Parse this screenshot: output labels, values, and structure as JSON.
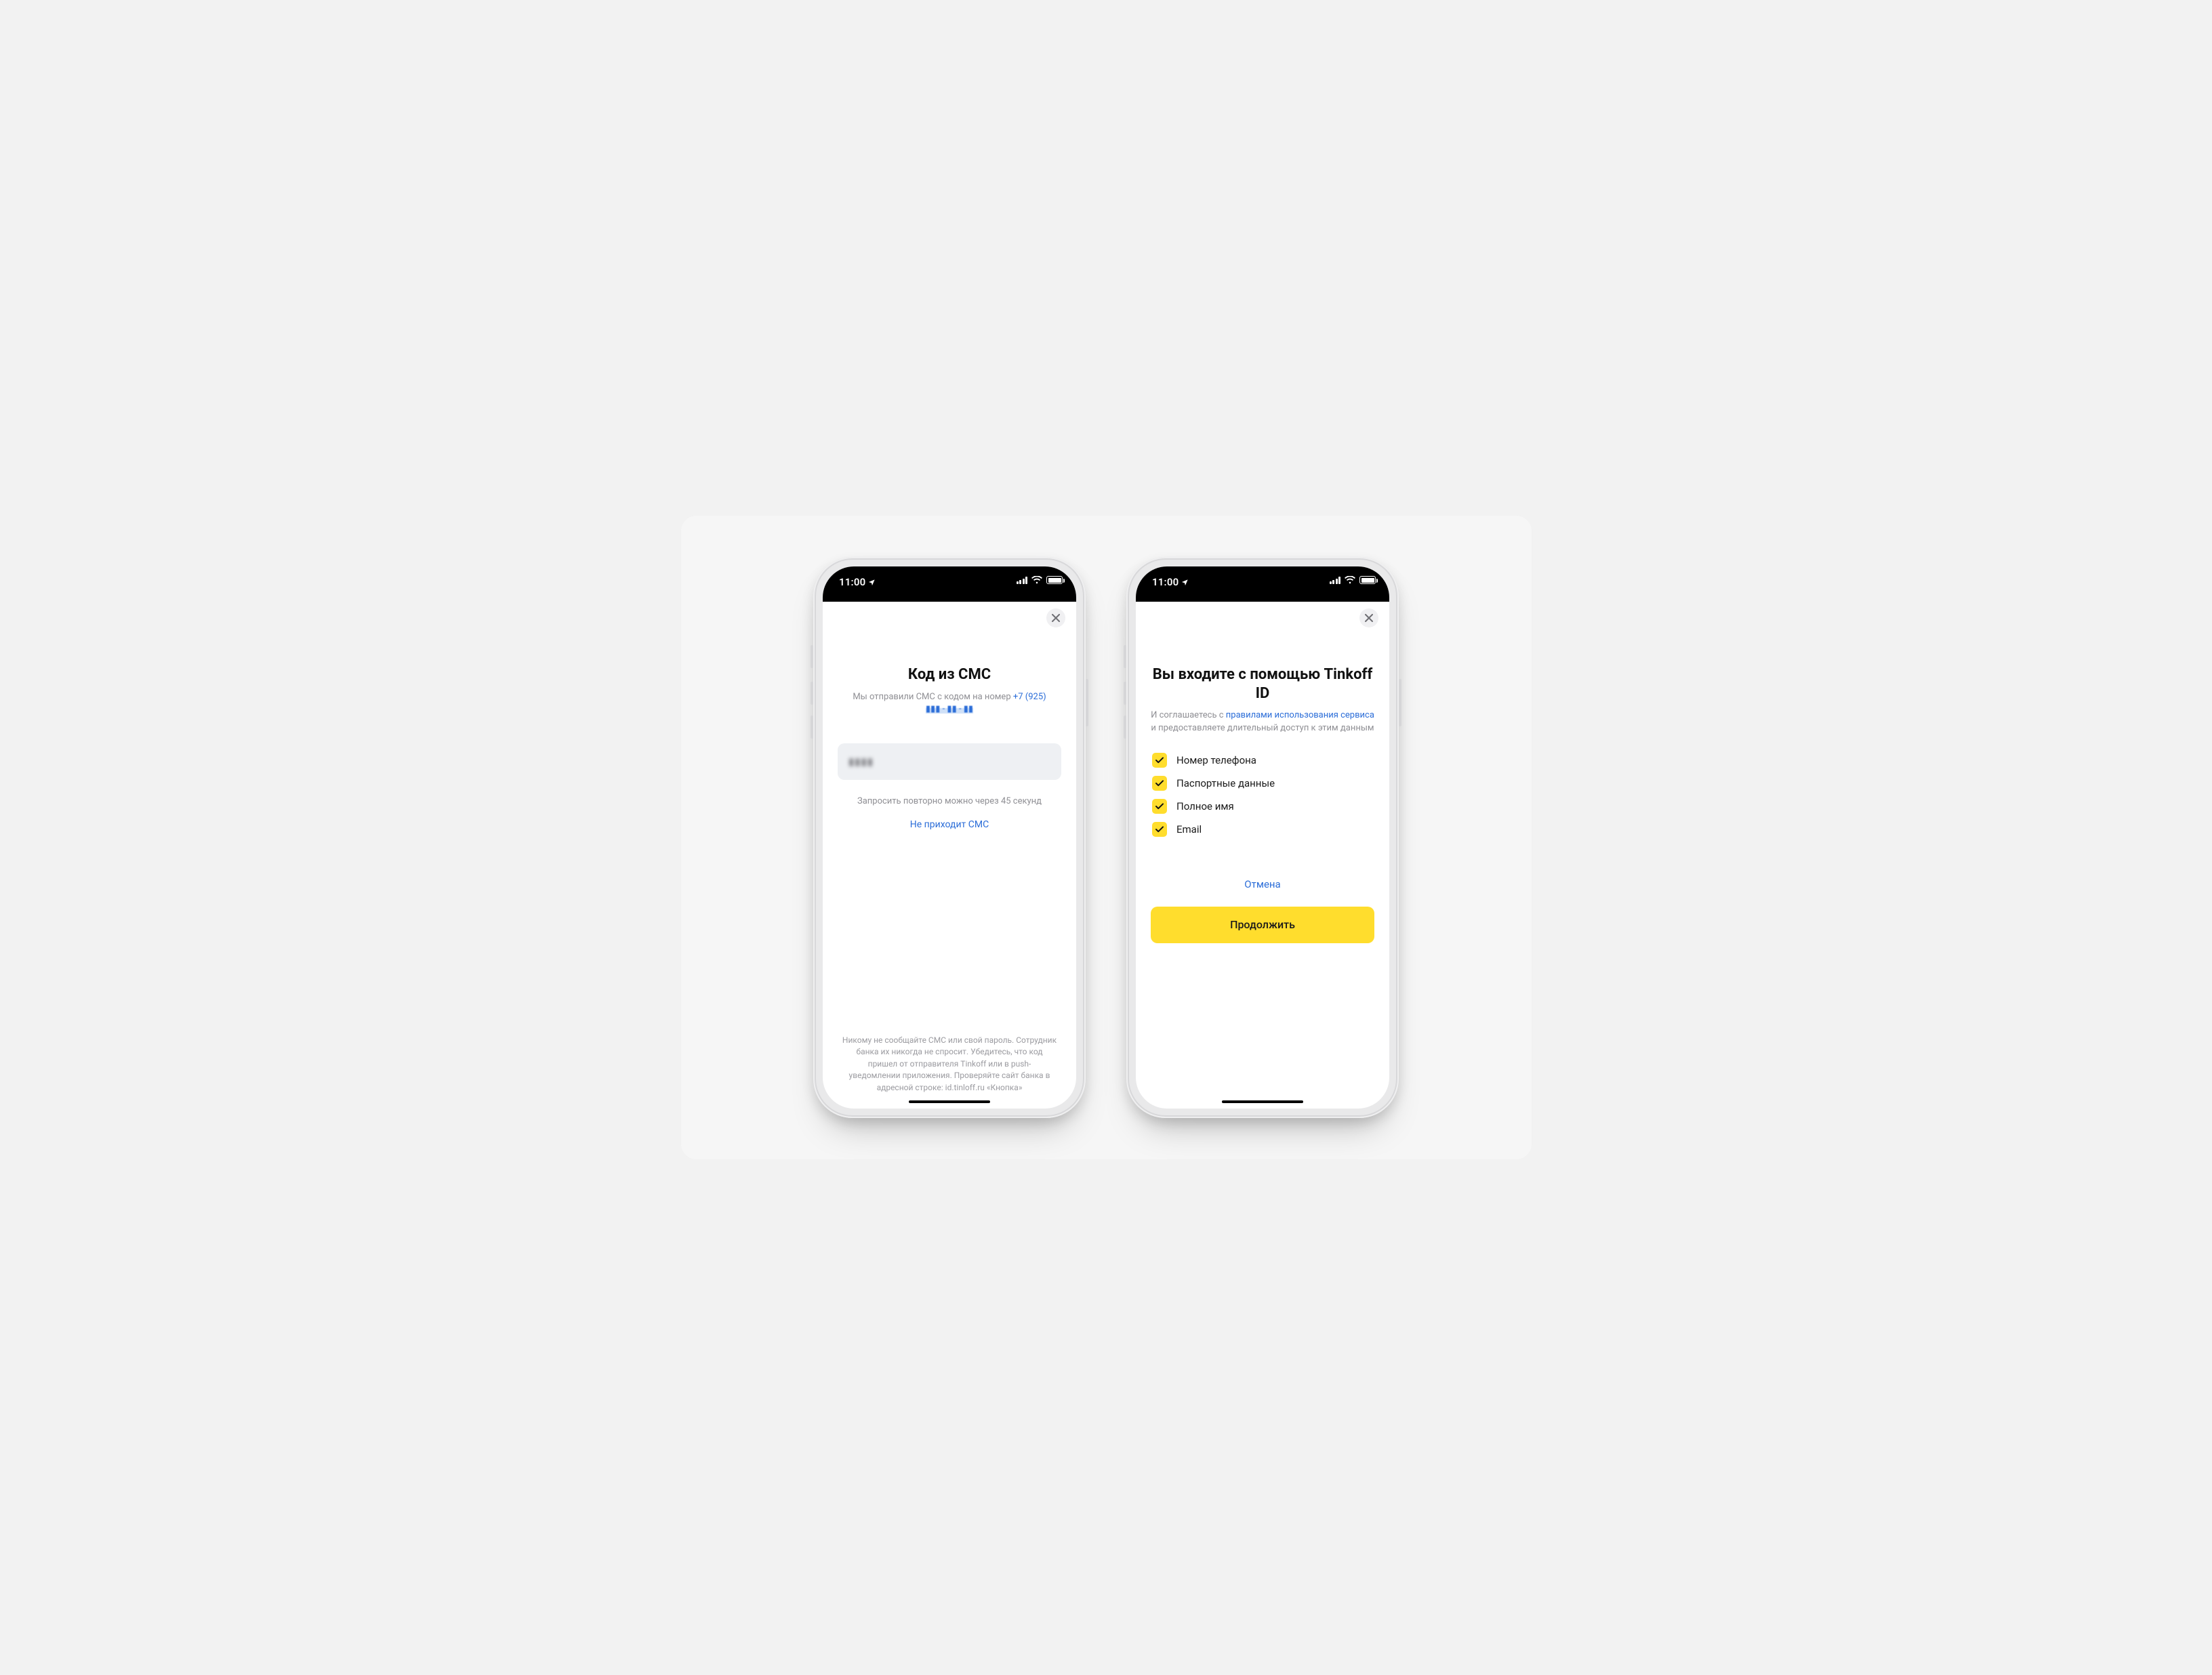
{
  "status": {
    "time": "11:00"
  },
  "sms": {
    "title": "Код из СМС",
    "subtitle_prefix": "Мы отправили СМС с кодом на номер ",
    "phone": "+7 (925)",
    "phone_masked": "▮▮▮ - ▮▮ - ▮▮",
    "code_value": "▮▮▮▮",
    "resend_hint": "Запросить повторно можно через 45 секунд",
    "no_sms_link": "Не приходит СМС",
    "footer": "Никому не сообщайте СМС или свой пароль. Сотрудник банка их никогда не спросит. Убедитесь, что код пришел от отправителя Tinkoff или в push- уведомлении приложения. Проверяйте сайт банка в адресной строке: id.tinloff.ru «Кнопка»"
  },
  "consent": {
    "title": "Вы входите с помощью Tinkoff ID",
    "sub_prefix": "И соглашаетесь с ",
    "sub_link": "правилами использования сервиса",
    "sub_suffix": " и предоставляете длительный доступ к этим данным",
    "items": [
      "Номер телефона",
      "Паспортные данные",
      "Полное имя",
      "Email"
    ],
    "cancel": "Отмена",
    "continue": "Продолжить"
  }
}
